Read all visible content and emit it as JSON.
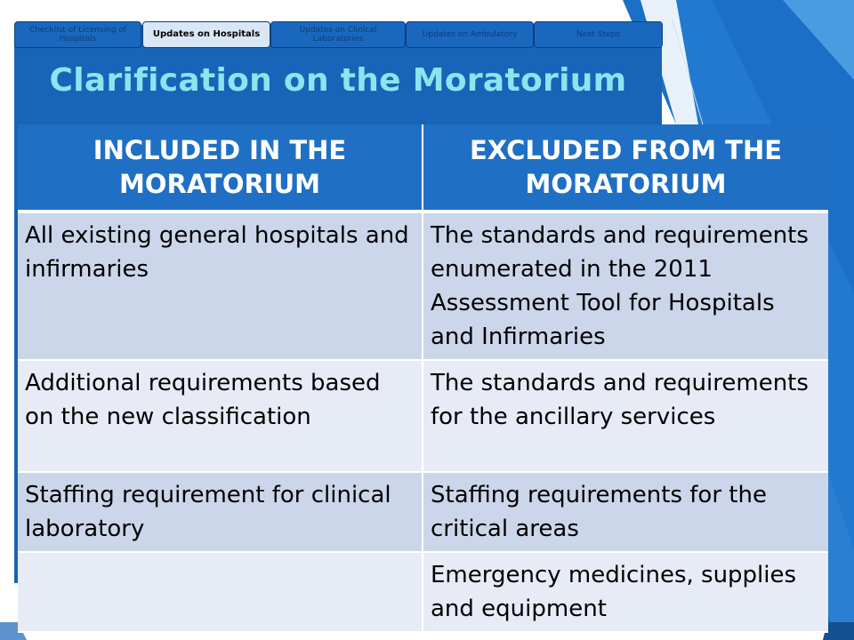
{
  "tabs": [
    {
      "label": "Checklist of Licensing of Hospitals",
      "active": false
    },
    {
      "label": "Updates on Hospitals",
      "active": true
    },
    {
      "label": "Updates on Clinical Laboratories",
      "active": false
    },
    {
      "label": "Updates on Ambulatory",
      "active": false
    },
    {
      "label": "Next Steps",
      "active": false
    }
  ],
  "title": "Clarification on the Moratorium",
  "table": {
    "headers": [
      "INCLUDED IN THE MORATORIUM",
      "EXCLUDED FROM THE MORATORIUM"
    ],
    "rows": [
      [
        "All existing general hospitals and infirmaries",
        "The standards and requirements enumerated in the 2011 Assessment Tool for Hospitals and Infirmaries"
      ],
      [
        "Additional requirements based on the new classification",
        "The standards and requirements for the ancillary services"
      ],
      [
        "Staffing requirement for clinical laboratory",
        "Staffing requirements for the critical areas"
      ],
      [
        "",
        "Emergency medicines, supplies and equipment"
      ]
    ]
  },
  "colors": {
    "panel": "#1764b8",
    "title": "#8ee3ef",
    "header_bg": "#1f6fc4",
    "row_odd": "#ccd6ea",
    "row_even": "#e7ebf5"
  }
}
